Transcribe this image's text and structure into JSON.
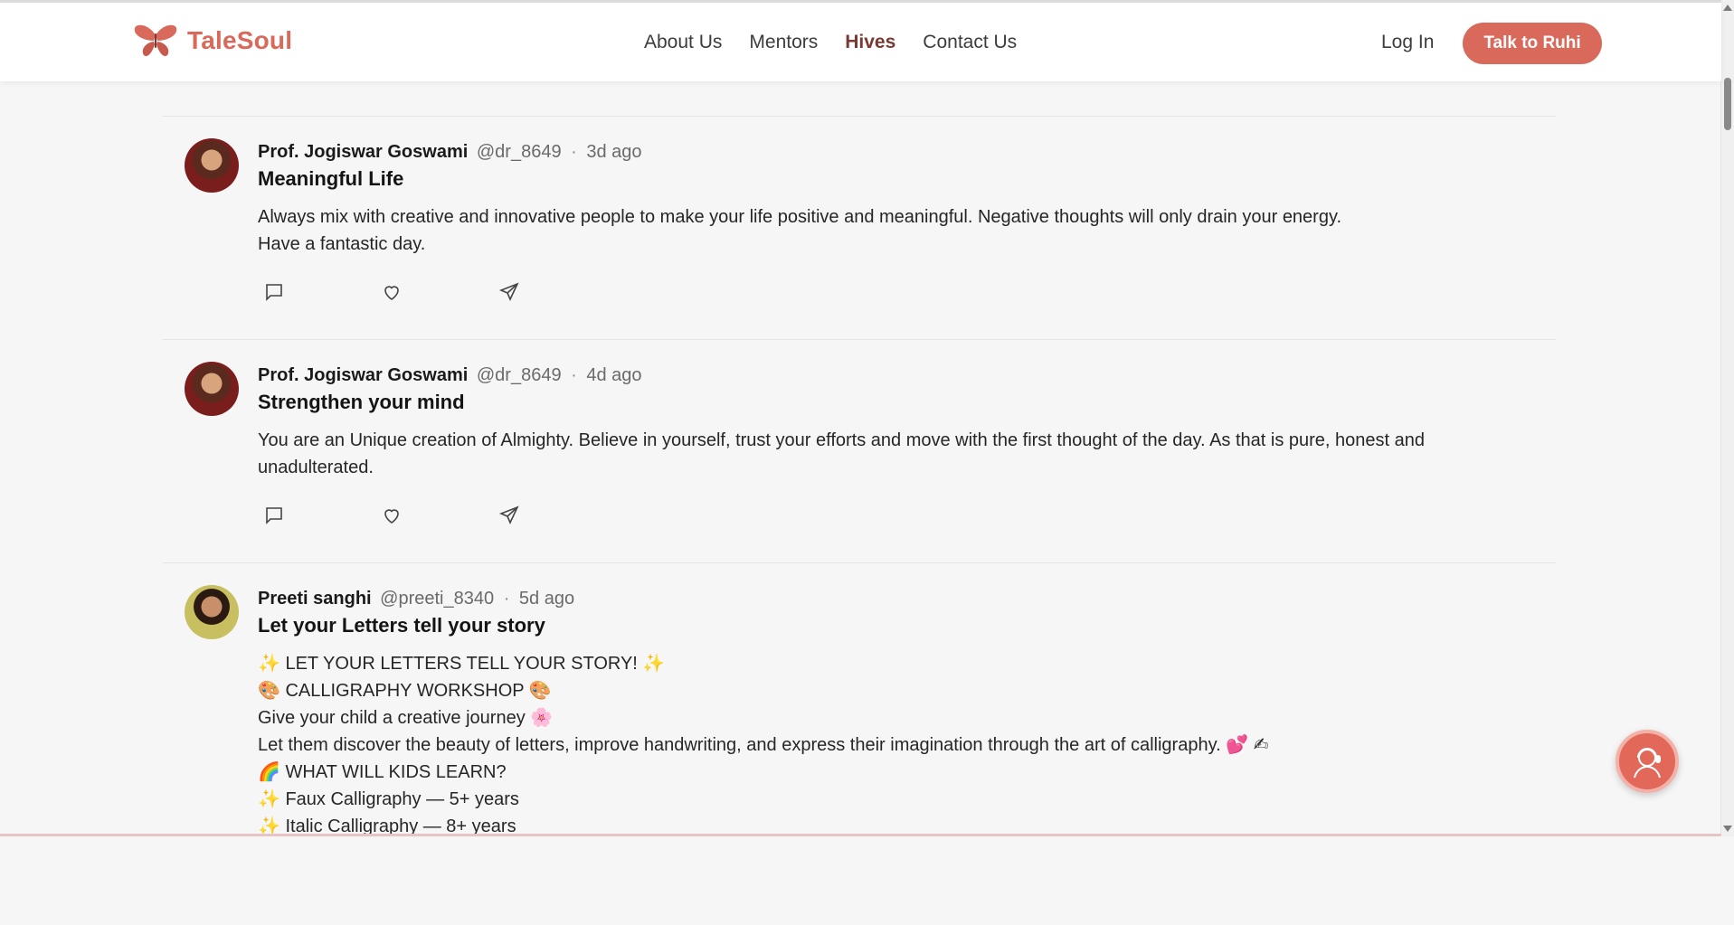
{
  "header": {
    "brand": "TaleSoul",
    "nav": [
      "About Us",
      "Mentors",
      "Hives",
      "Contact Us"
    ],
    "active_nav": "Hives",
    "login": "Log In",
    "cta": "Talk to Ruhi"
  },
  "colors": {
    "brand": "#d8695b",
    "active_nav": "#7a3a33",
    "background": "#f6f6f6"
  },
  "posts": [
    {
      "author": "Prof. Jogiswar Goswami",
      "handle": "@dr_8649",
      "time": "3d ago",
      "title": "Meaningful Life",
      "lines": [
        "Always mix with creative and innovative people to make your life positive and meaningful. Negative thoughts will only drain your energy.",
        "Have a fantastic day."
      ]
    },
    {
      "author": "Prof. Jogiswar Goswami",
      "handle": "@dr_8649",
      "time": "4d ago",
      "title": "Strengthen your mind",
      "lines": [
        "You are an Unique creation of Almighty. Believe in yourself, trust your efforts and move with the first thought of the day. As that is pure, honest and unadulterated."
      ]
    },
    {
      "author": "Preeti sanghi",
      "handle": "@preeti_8340",
      "time": "5d ago",
      "title": "Let your Letters tell your story",
      "lines": [
        "✨ LET YOUR LETTERS TELL YOUR STORY! ✨",
        "🎨 CALLIGRAPHY WORKSHOP 🎨",
        "Give your child a creative journey 🌸",
        "Let them discover the beauty of letters, improve handwriting, and express their imagination through the art of calligraphy. 💕 ✍",
        "🌈 WHAT WILL KIDS LEARN?",
        "✨ Faux Calligraphy — 5+ years",
        "✨ Italic Calligraphy — 8+ years"
      ]
    }
  ],
  "icons": {
    "comment": "comment-icon",
    "like": "heart-icon",
    "share": "send-icon",
    "chat": "chat-assistant-icon",
    "logo": "butterfly-logo-icon"
  }
}
